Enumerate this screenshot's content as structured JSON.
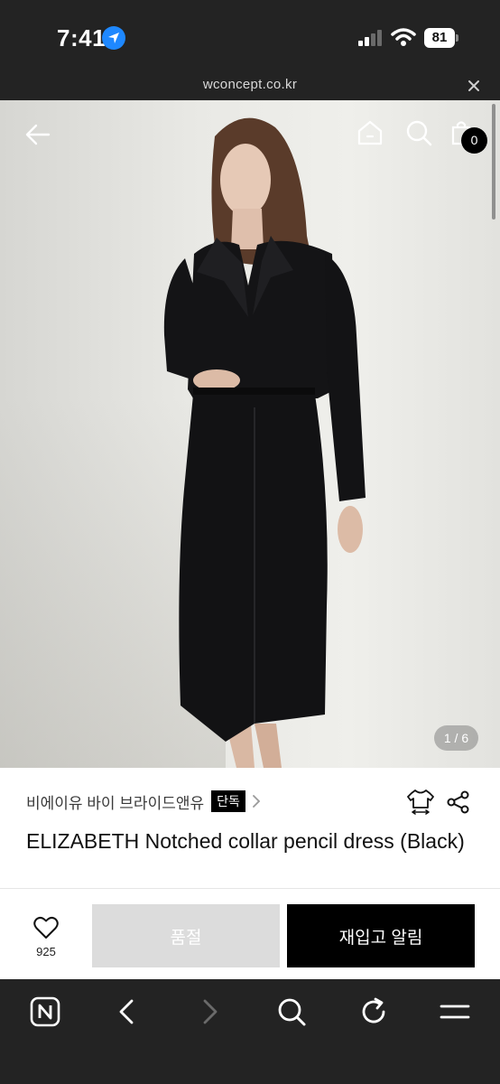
{
  "status_bar": {
    "time": "7:41",
    "battery": "81"
  },
  "url_bar": {
    "url": "wconcept.co.kr"
  },
  "hero": {
    "cart_count": "0",
    "page_indicator": "1 / 6"
  },
  "product": {
    "brand": "비에이유 바이 브라이드앤유",
    "badge": "단독",
    "title": "ELIZABETH Notched collar pencil dress (Black)"
  },
  "actions": {
    "like_count": "925",
    "soldout_label": "품절",
    "restock_label": "재입고 알림"
  },
  "colors": {
    "accent": "#000000",
    "disabled": "#dcdcdc",
    "chrome": "#232323"
  },
  "icons": [
    "location-arrow-icon",
    "signal-icon",
    "wifi-icon",
    "battery-icon",
    "close-icon",
    "back-arrow-icon",
    "home-icon",
    "search-icon",
    "shopping-bag-icon",
    "chevron-right-icon",
    "size-guide-icon",
    "share-icon",
    "heart-icon",
    "naver-icon",
    "reload-icon",
    "menu-icon"
  ]
}
